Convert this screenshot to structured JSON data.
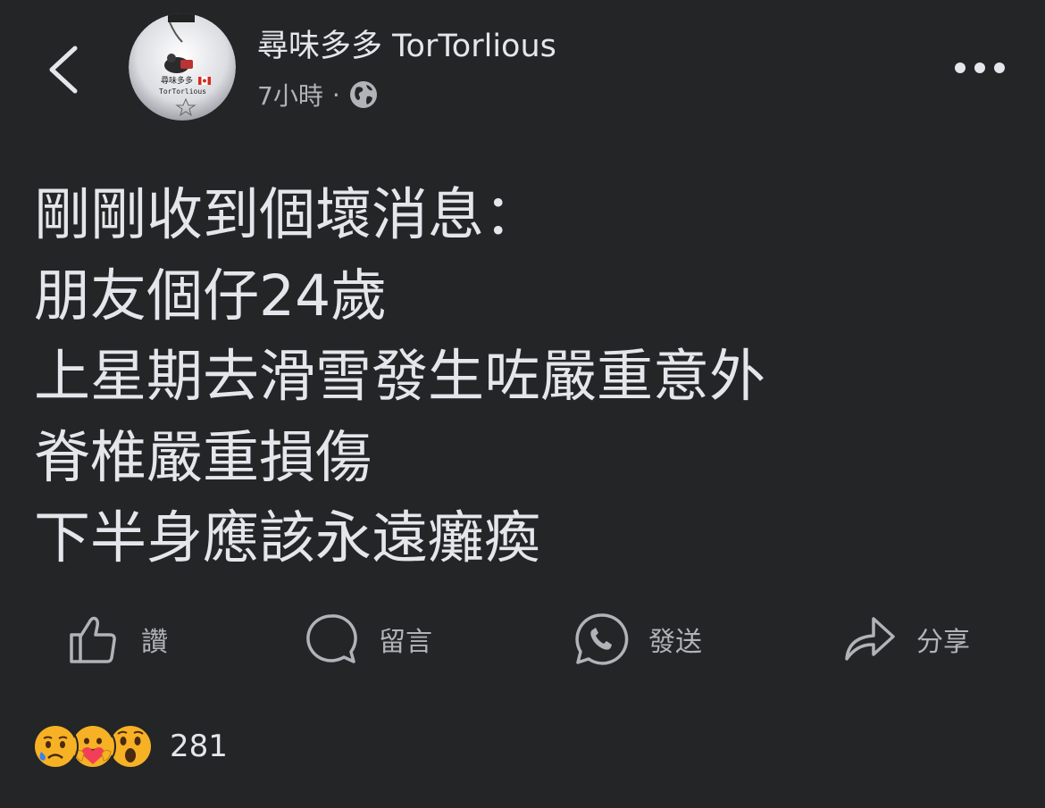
{
  "header": {
    "page_name": "尋味多多 TorTorlious",
    "time_ago": "7小時",
    "separator": "·",
    "audience_icon": "globe-icon",
    "back_icon": "chevron-left-icon",
    "more_icon": "more-horizontal-icon",
    "avatar": {
      "text_top": "尋味多多",
      "text_bottom": "TorTorlious",
      "flag": "canada-flag"
    }
  },
  "post": {
    "lines": [
      "剛剛收到個壞消息：",
      "朋友個仔24歲",
      "上星期去滑雪發生咗嚴重意外",
      "脊椎嚴重損傷",
      "下半身應該永遠癱瘓"
    ]
  },
  "actions": [
    {
      "label": "讚",
      "icon": "thumbs-up-icon"
    },
    {
      "label": "留言",
      "icon": "comment-bubble-icon"
    },
    {
      "label": "發送",
      "icon": "messenger-icon"
    },
    {
      "label": "分享",
      "icon": "share-arrow-icon"
    }
  ],
  "reactions": {
    "icons": [
      "sad-reaction-icon",
      "care-reaction-icon",
      "wow-reaction-icon"
    ],
    "count": "281"
  },
  "colors": {
    "background": "#242526",
    "primary_text": "#e4e6eb",
    "secondary_text": "#b0b3b8",
    "reaction_yellow": "#f7b125",
    "care_heart": "#f33e58"
  }
}
